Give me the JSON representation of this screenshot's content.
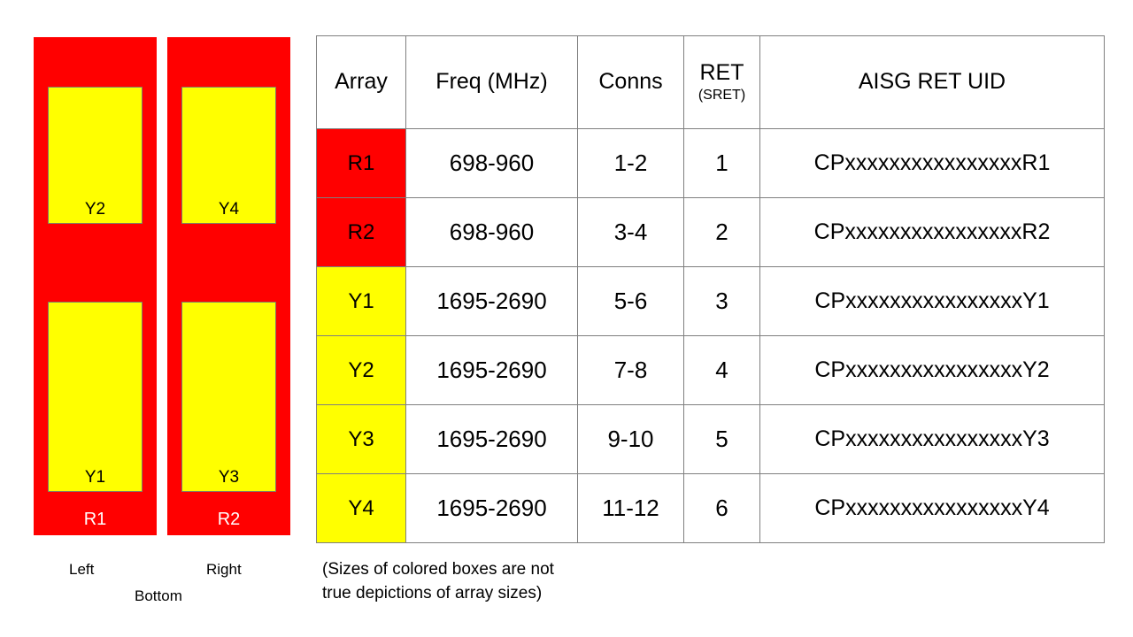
{
  "diagram": {
    "panels": [
      {
        "name": "R1",
        "label": "R1",
        "side_label": "Left",
        "boxes": [
          {
            "label": "Y2",
            "position": "upper"
          },
          {
            "label": "Y1",
            "position": "lower"
          }
        ]
      },
      {
        "name": "R2",
        "label": "R2",
        "side_label": "Right",
        "boxes": [
          {
            "label": "Y4",
            "position": "upper"
          },
          {
            "label": "Y3",
            "position": "lower"
          }
        ]
      }
    ],
    "orientation": {
      "left": "Left",
      "right": "Right",
      "bottom": "Bottom"
    },
    "colors": {
      "panel_fill": "#FF0000",
      "box_fill": "#FFFF00",
      "panel_label_text": "#FFFFFF",
      "box_label_text": "#000000"
    }
  },
  "table": {
    "headers": {
      "array": "Array",
      "freq": "Freq (MHz)",
      "conns": "Conns",
      "ret": "RET",
      "ret_sub": "(SRET)",
      "uid": "AISG RET UID"
    },
    "rows": [
      {
        "array": "R1",
        "array_fill": "#FF0000",
        "freq": "698-960",
        "conns": "1-2",
        "ret": "1",
        "uid": "CPxxxxxxxxxxxxxxxxR1"
      },
      {
        "array": "R2",
        "array_fill": "#FF0000",
        "freq": "698-960",
        "conns": "3-4",
        "ret": "2",
        "uid": "CPxxxxxxxxxxxxxxxxR2"
      },
      {
        "array": "Y1",
        "array_fill": "#FFFF00",
        "freq": "1695-2690",
        "conns": "5-6",
        "ret": "3",
        "uid": "CPxxxxxxxxxxxxxxxxY1"
      },
      {
        "array": "Y2",
        "array_fill": "#FFFF00",
        "freq": "1695-2690",
        "conns": "7-8",
        "ret": "4",
        "uid": "CPxxxxxxxxxxxxxxxxY2"
      },
      {
        "array": "Y3",
        "array_fill": "#FFFF00",
        "freq": "1695-2690",
        "conns": "9-10",
        "ret": "5",
        "uid": "CPxxxxxxxxxxxxxxxxY3"
      },
      {
        "array": "Y4",
        "array_fill": "#FFFF00",
        "freq": "1695-2690",
        "conns": "11-12",
        "ret": "6",
        "uid": "CPxxxxxxxxxxxxxxxxY4"
      }
    ]
  },
  "note": {
    "line1": "(Sizes of colored boxes are not",
    "line2": "true depictions of array sizes)"
  }
}
